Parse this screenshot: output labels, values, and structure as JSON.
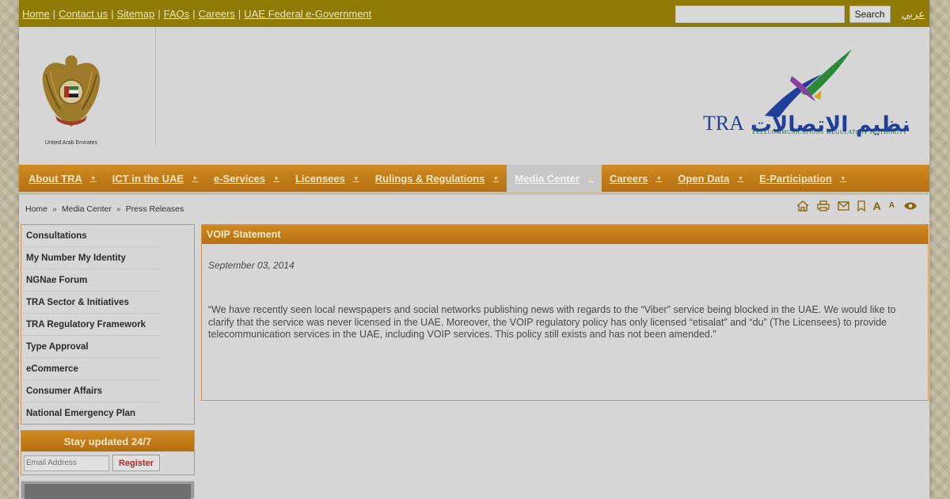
{
  "topbar": {
    "links": [
      "Home",
      "Contact us",
      "Sitemap",
      "FAQs",
      "Careers",
      "UAE Federal e-Government"
    ],
    "search_placeholder": "",
    "search_button": "Search",
    "lang_link": "عربي"
  },
  "header": {
    "emblem_caption": "United Arab Emirates",
    "logo_latin": "TRA",
    "logo_arabic": "هيئة تنظيم الاتصالات",
    "logo_english": "Telecommunications Regulatory Authority"
  },
  "nav": {
    "items": [
      "About TRA",
      "ICT in the UAE",
      "e-Services",
      "Licensees",
      "Rulings & Regulations",
      "Media Center",
      "Careers",
      "Open Data",
      "E-Participation"
    ],
    "active_index": 5
  },
  "breadcrumb": {
    "items": [
      "Home",
      "Media Center",
      "Press Releases"
    ],
    "separator": "»"
  },
  "tools": {
    "icons": [
      "home-icon",
      "print-icon",
      "mail-icon",
      "bookmark-icon",
      "font-increase-icon",
      "font-decrease-icon",
      "speaker-icon"
    ],
    "font_large": "A",
    "font_small": "A"
  },
  "sidebar": {
    "items": [
      "Consultations",
      "My Number My Identity",
      "NGNae Forum",
      "TRA Sector & Initiatives",
      "TRA Regulatory Framework",
      "Type Approval",
      "eCommerce",
      "Consumer Affairs",
      "National Emergency Plan"
    ]
  },
  "newsletter": {
    "title": "Stay updated 24/7",
    "email_placeholder": "Email Address",
    "register_button": "Register"
  },
  "article": {
    "title": "VOIP Statement",
    "date": "September 03, 2014",
    "body": "“We have recently seen local newspapers and social networks publishing news with regards to the “Viber” service being blocked in the UAE. We would like to clarify that the service was never licensed in the UAE. Moreover, the VOIP regulatory policy has only licensed “etisalat” and “du” (The Licensees) to provide telecommunication services in the UAE, including VOIP services. This policy still exists and has not been amended.”"
  },
  "colors": {
    "topbar": "#8f7a05",
    "nav_orange": "#c57d18",
    "panel_border": "#d49248",
    "logo_blue": "#1f3f9c",
    "logo_green": "#2a8a3a"
  }
}
